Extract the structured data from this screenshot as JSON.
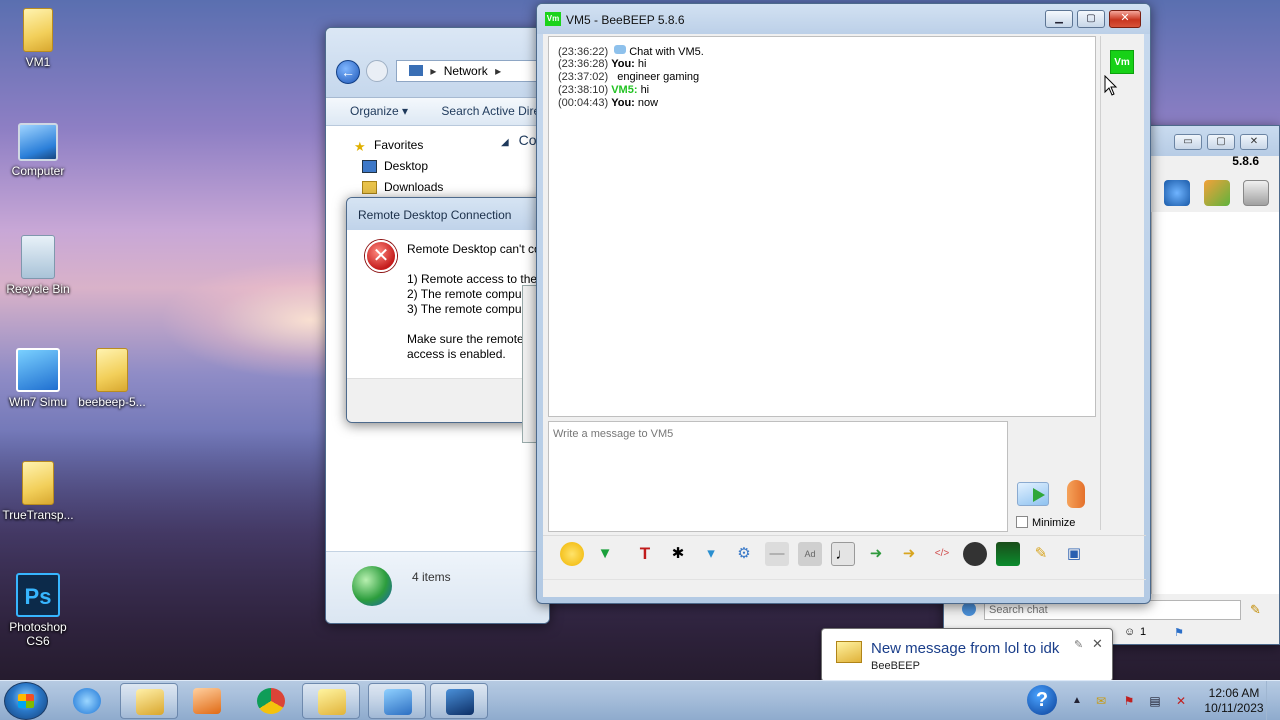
{
  "desktop": {
    "icons": [
      {
        "label": "VM1"
      },
      {
        "label": "Computer"
      },
      {
        "label": "Recycle Bin"
      },
      {
        "label": "Win7 Simu"
      },
      {
        "label": "beebeep-5..."
      },
      {
        "label": "TrueTransp..."
      },
      {
        "label": "Photoshop CS6"
      }
    ]
  },
  "explorer": {
    "address_root": "Network",
    "cmd": {
      "organize": "Organize ▾",
      "search_ad": "Search Active Dire"
    },
    "tree": {
      "favorites": "Favorites",
      "desktop": "Desktop",
      "downloads": "Downloads"
    },
    "right_header": "Co",
    "status_text": "4 items"
  },
  "rdp": {
    "title": "Remote Desktop Connection",
    "line1": "Remote Desktop can't co",
    "reason1": "1) Remote access to the",
    "reason2": "2) The remote compu",
    "reason3": "3) The remote compu",
    "hint1": "Make sure the remote",
    "hint2": "access is enabled."
  },
  "chat": {
    "icon_text": "Vm",
    "title": "VM5 - BeeBEEP 5.8.6",
    "avatar_text": "Vm",
    "messages": [
      {
        "time": "(23:36:22)",
        "sender": "",
        "text": "Chat with VM5.",
        "system": true
      },
      {
        "time": "(23:36:28)",
        "sender": "You:",
        "text": "hi"
      },
      {
        "time": "(23:37:02)",
        "sender": "",
        "text": "engineer gaming"
      },
      {
        "time": "(23:38:10)",
        "sender": "VM5:",
        "text": "hi",
        "remote": true
      },
      {
        "time": "(00:04:43)",
        "sender": "You:",
        "text": "now"
      }
    ],
    "compose_placeholder": "Write a message to VM5",
    "minimize_label": "Minimize"
  },
  "bee2": {
    "version": "5.8.6",
    "search_placeholder": "Search chat",
    "bottom_count": "1"
  },
  "notification": {
    "title": "New message from lol to idk",
    "app": "BeeBEEP"
  },
  "taskbar": {
    "time": "12:06 AM",
    "date": "10/11/2023"
  },
  "colors": {
    "beebeep_green": "#17d117",
    "close_red": "#c8351f",
    "remote_user": "#22c322"
  }
}
